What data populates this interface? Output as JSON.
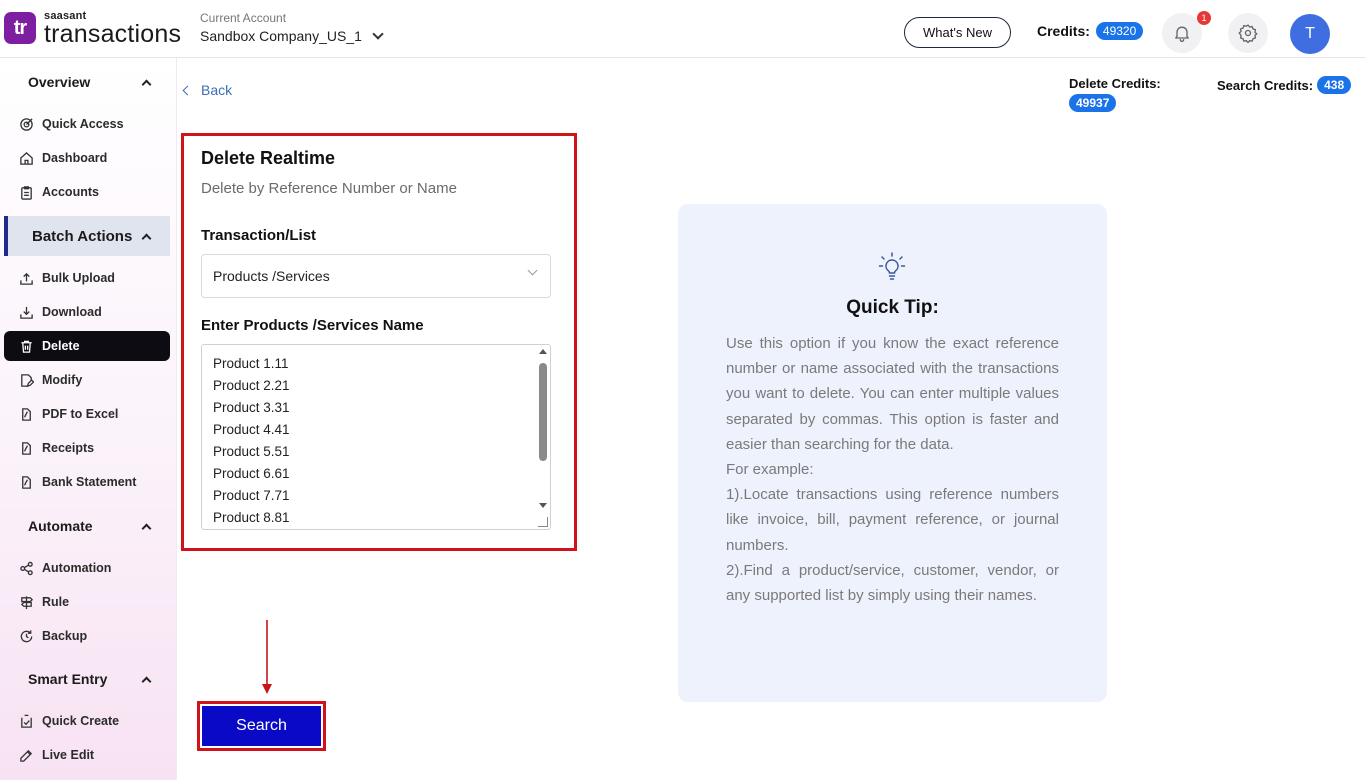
{
  "header": {
    "logo": {
      "mark": "tr",
      "brand": "saasant",
      "product": "transactions"
    },
    "account": {
      "label": "Current Account",
      "value": "Sandbox Company_US_1"
    },
    "whats_new_label": "What's New",
    "credits_label": "Credits:",
    "credits_value": "49320",
    "notification_count": "1",
    "avatar_initial": "T"
  },
  "sidebar": {
    "sections": [
      {
        "title": "Overview",
        "items": [
          "Quick Access",
          "Dashboard",
          "Accounts"
        ]
      },
      {
        "title": "Batch Actions",
        "items": [
          "Bulk Upload",
          "Download",
          "Delete",
          "Modify",
          "PDF to Excel",
          "Receipts",
          "Bank Statement"
        ]
      },
      {
        "title": "Automate",
        "items": [
          "Automation",
          "Rule",
          "Backup"
        ]
      },
      {
        "title": "Smart Entry",
        "items": [
          "Quick Create",
          "Live Edit"
        ]
      }
    ],
    "active_section": "Batch Actions",
    "selected_item": "Delete"
  },
  "main": {
    "back_label": "Back",
    "delete_credits": {
      "label": "Delete Credits:",
      "value": "49937"
    },
    "search_credits": {
      "label": "Search Credits:",
      "value": "438"
    },
    "panel": {
      "title": "Delete Realtime",
      "subtitle": "Delete by Reference Number or Name",
      "transaction_label": "Transaction/List",
      "transaction_value": "Products /Services",
      "names_label": "Enter Products /Services Name",
      "names_values": [
        "Product 1.11",
        "Product 2.21",
        "Product 3.31",
        "Product 4.41",
        "Product 5.51",
        "Product 6.61",
        "Product 7.71",
        "Product 8.81"
      ]
    },
    "tip": {
      "title": "Quick Tip:",
      "paragraph": "Use this option if you know the exact reference number or name associated with the transactions you want to delete. You can enter multiple values separated by commas. This option is faster and easier than searching for the data.",
      "example_label": "For example:",
      "example1": "1).Locate transactions using reference numbers like invoice, bill, payment reference, or journal numbers.",
      "example2": "2).Find a product/service, customer, vendor, or any supported list by simply using their names."
    },
    "search_label": "Search"
  },
  "colors": {
    "accent": "#0a0ac6",
    "highlight": "#d0121b",
    "pill": "#1a73e8",
    "tip_bg": "#eef2fd"
  }
}
